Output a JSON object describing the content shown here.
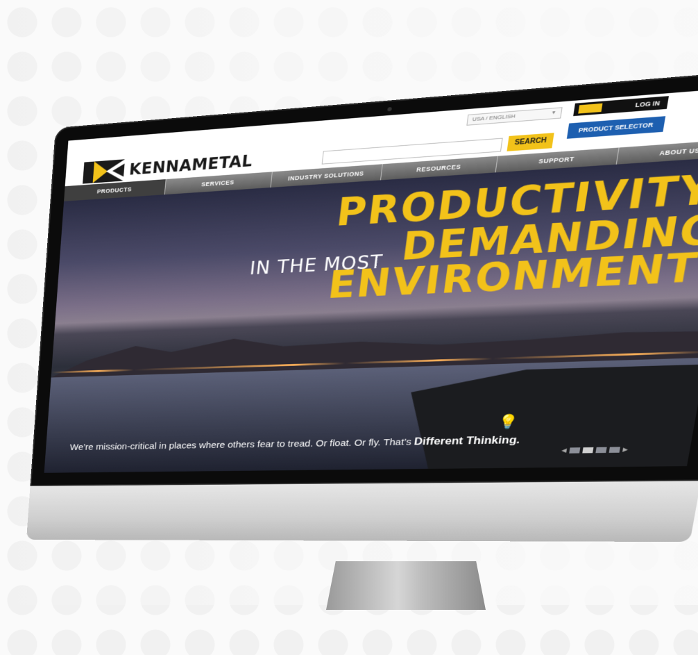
{
  "brand": {
    "name": "KENNAMETAL",
    "accent": "#f2c21a",
    "blue": "#1d5fb0"
  },
  "header": {
    "language": "USA / ENGLISH",
    "login": "LOG IN",
    "search_button": "SEARCH",
    "product_selector": "PRODUCT SELECTOR"
  },
  "nav": [
    "PRODUCTS",
    "SERVICES",
    "INDUSTRY SOLUTIONS",
    "RESOURCES",
    "SUPPORT",
    "ABOUT US"
  ],
  "hero": {
    "line1": "PRODUCTIVITY",
    "prefix": "IN THE MOST",
    "line2": "DEMANDING",
    "line3": "ENVIRONMENTS",
    "tagline": "We’re mission-critical in places where others fear to tread. Or float. Or fly. That’s",
    "tagline_bold": "Different Thinking.",
    "icon": "lightbulb-icon"
  },
  "pager": {
    "count": 4,
    "active": 1
  }
}
